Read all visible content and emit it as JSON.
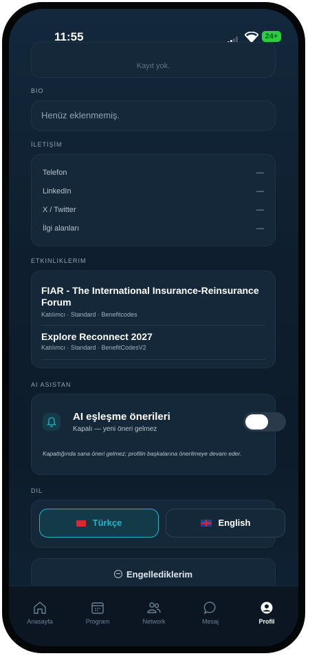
{
  "status": {
    "time": "11:55",
    "battery": "24+"
  },
  "top_card_text": "Kayıt yok.",
  "bio": {
    "section": "BIO",
    "value": "Henüz eklenmemiş."
  },
  "contact": {
    "section": "İLETİŞİM",
    "rows": [
      {
        "label": "Telefon",
        "value": "—"
      },
      {
        "label": "LinkedIn",
        "value": "—"
      },
      {
        "label": "X / Twitter",
        "value": "—"
      },
      {
        "label": "İlgi alanları",
        "value": "—"
      }
    ]
  },
  "events": {
    "section": "ETKINLIKLERIM",
    "items": [
      {
        "title": "FIAR - The International Insurance-Reinsurance Forum",
        "subtitle": "Katılımcı · Standard · Benefitcodes"
      },
      {
        "title": "Explore Reconnect 2027",
        "subtitle": "Katılımcı · Standard · BenefitCodesV2"
      }
    ]
  },
  "ai": {
    "section": "AI ASISTAN",
    "title": "AI eşleşme önerileri",
    "subtitle": "Kapalı — yeni öneri gelmez",
    "note": "Kapattığında sana öneri gelmez; profilin başkalarına önerilmeye devam eder.",
    "toggle_on": false
  },
  "language": {
    "section": "DIL",
    "options": [
      {
        "label": "Türkçe",
        "selected": true
      },
      {
        "label": "English",
        "selected": false
      }
    ]
  },
  "blocked": {
    "label": "Engellediklerim"
  },
  "nav": {
    "items": [
      {
        "label": "Anasayfa",
        "icon": "home-icon"
      },
      {
        "label": "Program",
        "icon": "calendar-icon"
      },
      {
        "label": "Network",
        "icon": "people-icon"
      },
      {
        "label": "Mesaj",
        "icon": "chat-icon"
      },
      {
        "label": "Profil",
        "icon": "profile-icon",
        "active": true
      }
    ]
  },
  "colors": {
    "accent": "#1fb6c8",
    "active_nav": "#ffffff",
    "toggle_off": "#2a3a4a"
  }
}
